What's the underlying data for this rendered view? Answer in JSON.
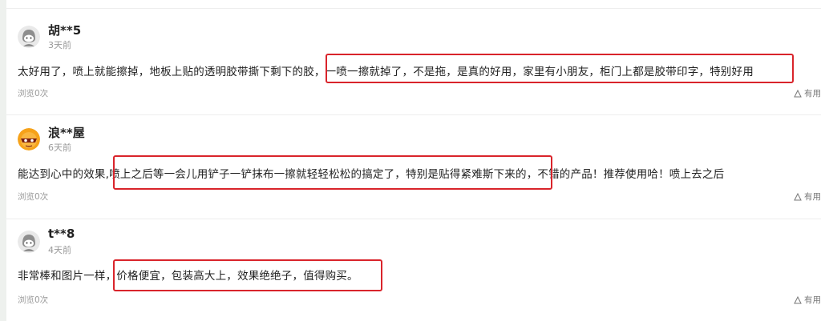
{
  "reviews": [
    {
      "user": "胡**5",
      "time": "3天前",
      "avatar_icon": "grey-cartoon-avatar-icon",
      "content": "太好用了，喷上就能擦掉，地板上贴的透明胶带撕下剩下的胶，一喷一擦就掉了，不是拖，是真的好用，家里有小朋友，柜门上都是胶带印字，特别好用",
      "views": "浏览0次",
      "useful": "有用"
    },
    {
      "user": "浪**屋",
      "time": "6天前",
      "avatar_icon": "orange-masked-avatar-icon",
      "content": "能达到心中的效果,喷上之后等一会儿用铲子一铲抹布一擦就轻轻松松的搞定了，特别是贴得紧难斯下来的，不错的产品！推荐使用哈！喷上去之后",
      "views": "浏览0次",
      "useful": "有用"
    },
    {
      "user": "t**8",
      "time": "4天前",
      "avatar_icon": "grey-cartoon-avatar-icon",
      "content": "非常棒和图片一样，价格便宜，包装高大上，效果绝绝子，值得购买。",
      "views": "浏览0次",
      "useful": "有用"
    }
  ],
  "colors": {
    "highlight_border": "#d9242b",
    "text_primary": "#222222",
    "text_muted": "#999999"
  }
}
